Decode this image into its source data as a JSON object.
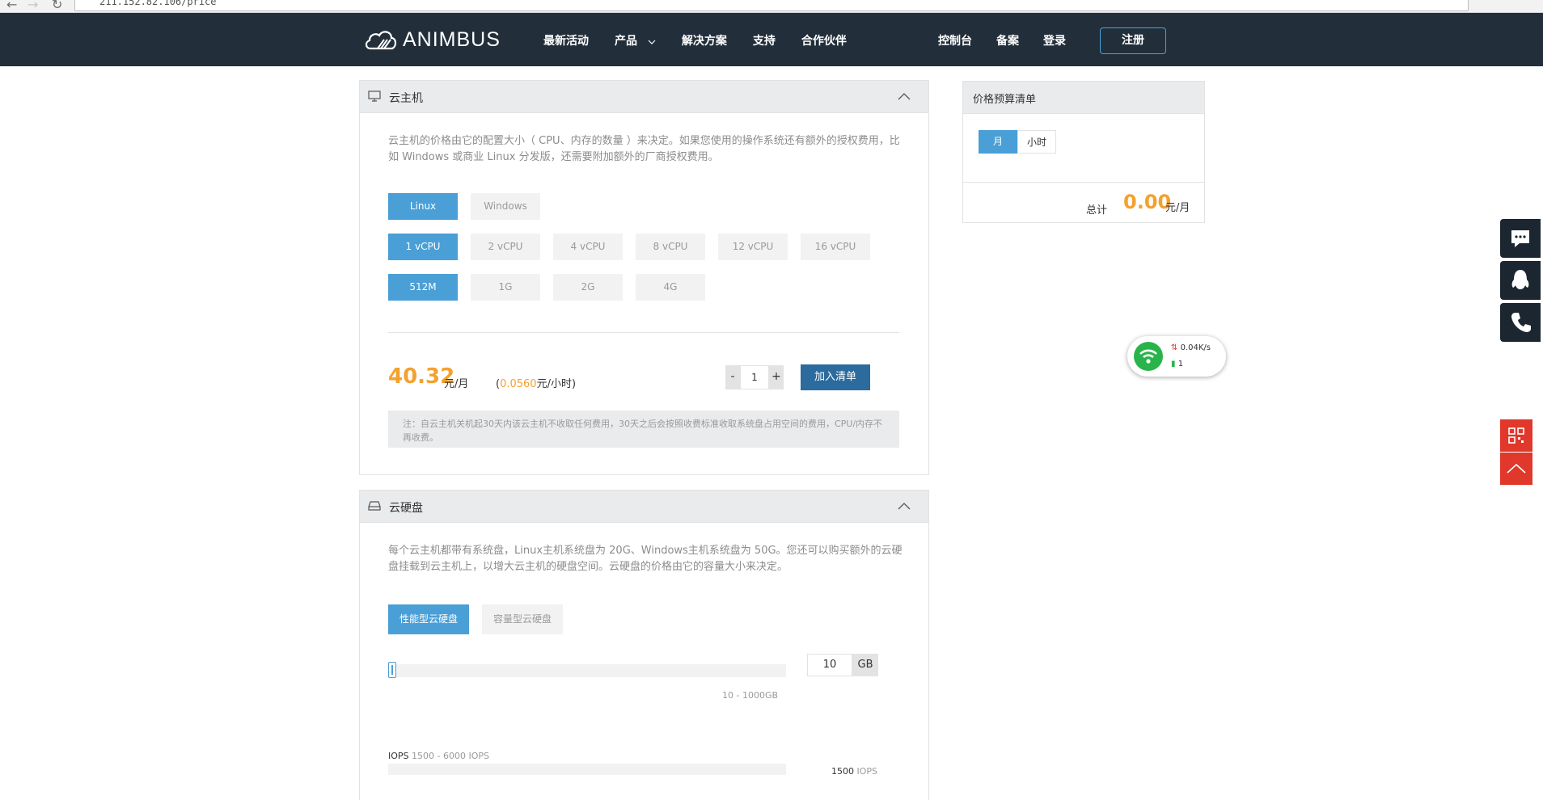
{
  "browser": {
    "url": "211.152.82.106/price"
  },
  "header": {
    "brand": "ANIMBUS",
    "nav": [
      "最新活动",
      "产品",
      "解决方案",
      "支持",
      "合作伙伴"
    ],
    "right_links": [
      "控制台",
      "备案",
      "登录"
    ],
    "register": "注册"
  },
  "vm_panel": {
    "title": "云主机",
    "description": "云主机的价格由它的配置大小（ CPU、内存的数量 ）来决定。如果您使用的操作系统还有额外的授权费用，比如 Windows 或商业 Linux 分发版，还需要附加额外的厂商授权费用。",
    "os_options": [
      "Linux",
      "Windows"
    ],
    "cpu_options": [
      "1 vCPU",
      "2 vCPU",
      "4 vCPU",
      "8 vCPU",
      "12 vCPU",
      "16 vCPU"
    ],
    "mem_options": [
      "512M",
      "1G",
      "2G",
      "4G"
    ],
    "price": "40.32",
    "price_unit": "元/月",
    "hour_open": "(",
    "hour_price": "0.0560",
    "hour_unit": "元/小时)",
    "qty_minus": "-",
    "qty": "1",
    "qty_plus": "+",
    "add_button": "加入清单",
    "note": "注：自云主机关机起30天内该云主机不收取任何费用，30天之后会按照收费标准收取系统盘占用空间的费用，CPU/内存不再收费。"
  },
  "disk_panel": {
    "title": "云硬盘",
    "description": "每个云主机都带有系统盘，Linux主机系统盘为 20G、Windows主机系统盘为 50G。您还可以购买额外的云硬盘挂载到云主机上，以增大云主机的硬盘空间。云硬盘的价格由它的容量大小来决定。",
    "types": [
      "性能型云硬盘",
      "容量型云硬盘"
    ],
    "size": "10",
    "size_unit": "GB",
    "size_range": "10 - 1000GB",
    "iops_title": "IOPS",
    "iops_range": "1500 - 6000 IOPS",
    "iops_value": "1500",
    "iops_unit": "IOPS"
  },
  "budget": {
    "title": "价格预算清单",
    "month": "月",
    "hour": "小时",
    "total_label": "总计",
    "total": "0.00",
    "total_unit": "元/月"
  },
  "net_widget": {
    "speed": "0.04K/s",
    "count": "1"
  },
  "colors": {
    "header_bg": "#222e3a",
    "accent_blue": "#4a9fd6",
    "price_orange": "#f4a12e",
    "add_button": "#2b6b9e",
    "side_red": "#e0382b"
  }
}
